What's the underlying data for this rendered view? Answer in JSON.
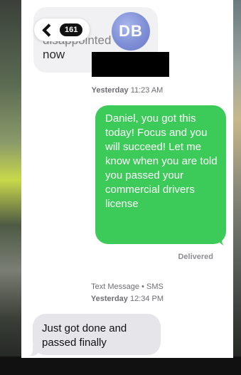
{
  "header": {
    "back_count": "161",
    "contact_initials": "DB"
  },
  "previous_message": {
    "text_partial": "a little disappointed",
    "text_last": "now"
  },
  "thread": {
    "timestamp_1": {
      "day": "Yesterday",
      "time": "11:23 AM"
    },
    "sent_message": "Daniel, you got this today!  Focus and you will succeed! Let me know when you are told you passed your commercial drivers license",
    "delivered_label": "Delivered",
    "service_label": "Text Message • SMS",
    "timestamp_2": {
      "day": "Yesterday",
      "time": "12:34 PM"
    },
    "received_message": "Just got done and passed finally"
  },
  "colors": {
    "sent_bubble": "#3ccb58",
    "received_bubble": "#e6e6ea",
    "avatar": "#7f8fd6"
  }
}
